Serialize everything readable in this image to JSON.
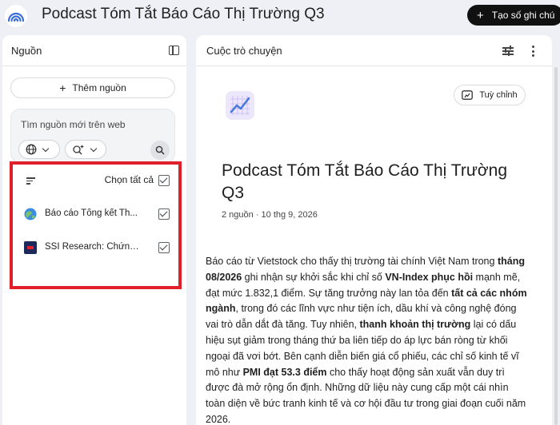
{
  "header": {
    "title": "Podcast Tóm Tắt Báo Cáo Thị Trường Q3",
    "create_note_label": "Tạo số ghi chú"
  },
  "sources_panel": {
    "title": "Nguồn",
    "add_source_label": "Thêm nguồn",
    "web_search_placeholder": "Tìm nguồn mới trên web",
    "select_all_label": "Chọn tất cả",
    "select_all_checked": true,
    "items": [
      {
        "label": "Báo cáo Tổng kết Th...",
        "icon": "globe-favicon",
        "checked": true
      },
      {
        "label": "SSI Research: Chứng...",
        "icon": "ssi-favicon",
        "checked": true
      }
    ]
  },
  "chat_panel": {
    "title": "Cuộc trò chuyện",
    "customize_label": "Tuỳ chỉnh",
    "note": {
      "icon": "chart-line-icon",
      "title": "Podcast Tóm Tắt Báo Cáo Thị Trường Q3",
      "meta": "2 nguồn · 10 thg 9, 2026",
      "body": [
        {
          "text": "Báo cáo từ Vietstock cho thấy thị trường tài chính Việt Nam trong ",
          "bold": false
        },
        {
          "text": "tháng 08/2026",
          "bold": true
        },
        {
          "text": " ghi nhận sự khởi sắc khi chỉ số ",
          "bold": false
        },
        {
          "text": "VN-Index phục hồi",
          "bold": true
        },
        {
          "text": " mạnh mẽ, đạt mức 1.832,1 điểm. Sự tăng trưởng này lan tỏa đến ",
          "bold": false
        },
        {
          "text": "tất cả các nhóm ngành",
          "bold": true
        },
        {
          "text": ", trong đó các lĩnh vực như tiện ích, dầu khí và công nghệ đóng vai trò dẫn dắt đà tăng. Tuy nhiên, ",
          "bold": false
        },
        {
          "text": "thanh khoản thị trường",
          "bold": true
        },
        {
          "text": " lại có dấu hiệu sụt giảm trong tháng thứ ba liên tiếp do áp lực bán ròng từ khối ngoại đã vơi bớt. Bên cạnh diễn biến giá cổ phiếu, các chỉ số kinh tế vĩ mô như ",
          "bold": false
        },
        {
          "text": "PMI đạt 53.3 điểm",
          "bold": true
        },
        {
          "text": " cho thấy hoạt động sản xuất vẫn duy trì được đà mở rộng ổn định. Những dữ liệu này cung cấp một cái nhìn toàn diện về bức tranh kinh tế và cơ hội đầu tư trong giai đoạn cuối năm 2026.",
          "bold": false
        }
      ]
    }
  },
  "colors": {
    "accent_highlight": "#e0202a",
    "background": "#eef0f5",
    "create_button": "#111111"
  }
}
